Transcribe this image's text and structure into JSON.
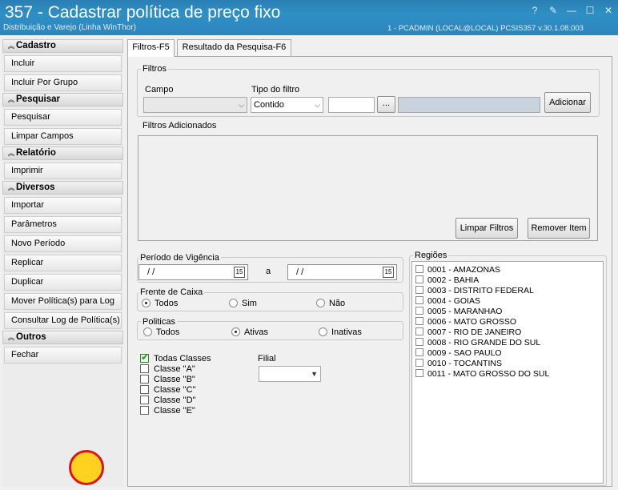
{
  "window": {
    "title": "357 - Cadastrar política de preço fixo",
    "subtitle": "Distribuição e Varejo (Linha WinThor)",
    "session": "1 - PCADMIN (LOCAL@LOCAL)    PCSIS357  v.30.1.08.003",
    "controls": [
      "?",
      "✎",
      "—",
      "☐",
      "✕"
    ]
  },
  "sidebar": {
    "groups": [
      {
        "label": "Cadastro",
        "items": [
          "Incluir",
          "Incluir Por Grupo"
        ]
      },
      {
        "label": "Pesquisar",
        "items": [
          "Pesquisar",
          "Limpar Campos"
        ]
      },
      {
        "label": "Relatório",
        "items": [
          "Imprimir"
        ]
      },
      {
        "label": "Diversos",
        "items": [
          "Importar",
          "Parâmetros",
          "Novo Período",
          "Replicar",
          "Duplicar",
          "Mover Política(s) para Log",
          "Consultar Log de Política(s)"
        ]
      },
      {
        "label": "Outros",
        "items": [
          "Fechar"
        ]
      }
    ]
  },
  "tabs": [
    "Filtros-F5",
    "Resultado da Pesquisa-F6"
  ],
  "filters": {
    "group_label": "Filtros",
    "campo_label": "Campo",
    "campo_value": "",
    "tipo_label": "Tipo do filtro",
    "tipo_value": "Contido",
    "ellipsis": "...",
    "add_button": "Adicionar",
    "added_label": "Filtros Adicionados",
    "clear_button": "Limpar Filtros",
    "remove_button": "Remover Item"
  },
  "periodo": {
    "label": "Período de Vigência",
    "from": "/  /",
    "to": "/  /",
    "separator": "a",
    "calendar_glyph": "15"
  },
  "frente": {
    "label": "Frente de Caixa",
    "options": [
      "Todos",
      "Sim",
      "Não"
    ],
    "selected": "Todos"
  },
  "politicas": {
    "label": "Politicas",
    "options": [
      "Todos",
      "Ativas",
      "Inativas"
    ],
    "selected": "Ativas"
  },
  "classes": {
    "items": [
      "Todas Classes",
      "Classe \"A\"",
      "Classe \"B\"",
      "Classe \"C\"",
      "Classe \"D\"",
      "Classe \"E\""
    ],
    "checked": "Todas Classes"
  },
  "filial": {
    "label": "Filial",
    "value": ""
  },
  "regioes": {
    "label": "Regiões",
    "items": [
      "0001 - AMAZONAS",
      "0002 - BAHIA",
      "0003 - DISTRITO FEDERAL",
      "0004 - GOIAS",
      "0005 - MARANHAO",
      "0006 - MATO GROSSO",
      "0007 - RIO DE JANEIRO",
      "0008 - RIO GRANDE DO SUL",
      "0009 - SAO PAULO",
      "0010 - TOCANTINS",
      "0011 - MATO GROSSO DO SUL"
    ]
  },
  "colors": {
    "titlebar": "#2c86be",
    "accent_ring": "#d81818",
    "cursor_fill": "#ffd21f"
  }
}
